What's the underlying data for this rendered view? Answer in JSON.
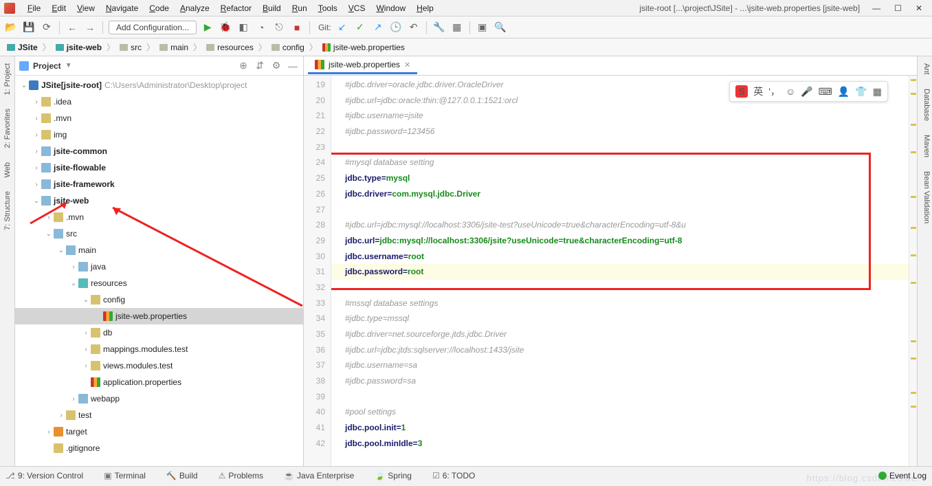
{
  "menus": [
    "File",
    "Edit",
    "View",
    "Navigate",
    "Code",
    "Analyze",
    "Refactor",
    "Build",
    "Run",
    "Tools",
    "VCS",
    "Window",
    "Help"
  ],
  "window_title": "jsite-root [...\\project\\JSite] - ...\\jsite-web.properties [jsite-web]",
  "toolbar": {
    "add_config": "Add Configuration...",
    "git": "Git:"
  },
  "breadcrumbs": [
    "JSite",
    "jsite-web",
    "src",
    "main",
    "resources",
    "config",
    "jsite-web.properties"
  ],
  "project_header": {
    "label": "Project"
  },
  "tree": [
    {
      "indent": 0,
      "arrow": "v",
      "icon": "project",
      "labelA": "JSite",
      "labelB": "[jsite-root]",
      "path": "C:\\Users\\Administrator\\Desktop\\project",
      "bold": true,
      "sel": false
    },
    {
      "indent": 1,
      "arrow": ">",
      "icon": "folder",
      "labelA": ".idea",
      "bold": false
    },
    {
      "indent": 1,
      "arrow": ">",
      "icon": "folder",
      "labelA": ".mvn",
      "bold": false
    },
    {
      "indent": 1,
      "arrow": ">",
      "icon": "folder",
      "labelA": "img",
      "bold": false
    },
    {
      "indent": 1,
      "arrow": ">",
      "icon": "folder-blue",
      "labelA": "jsite-common",
      "bold": true
    },
    {
      "indent": 1,
      "arrow": ">",
      "icon": "folder-blue",
      "labelA": "jsite-flowable",
      "bold": true
    },
    {
      "indent": 1,
      "arrow": ">",
      "icon": "folder-blue",
      "labelA": "jsite-framework",
      "bold": true
    },
    {
      "indent": 1,
      "arrow": "v",
      "icon": "folder-blue",
      "labelA": "jsite-web",
      "bold": true
    },
    {
      "indent": 2,
      "arrow": ">",
      "icon": "folder",
      "labelA": ".mvn",
      "bold": false
    },
    {
      "indent": 2,
      "arrow": "v",
      "icon": "folder-blue",
      "labelA": "src",
      "bold": false
    },
    {
      "indent": 3,
      "arrow": "v",
      "icon": "folder-blue",
      "labelA": "main",
      "bold": false
    },
    {
      "indent": 4,
      "arrow": ">",
      "icon": "folder-blue",
      "labelA": "java",
      "bold": false
    },
    {
      "indent": 4,
      "arrow": "v",
      "icon": "folder-teal",
      "labelA": "resources",
      "bold": false
    },
    {
      "indent": 5,
      "arrow": "v",
      "icon": "folder",
      "labelA": "config",
      "bold": false
    },
    {
      "indent": 6,
      "arrow": "",
      "icon": "properties",
      "labelA": "jsite-web.properties",
      "bold": false,
      "sel": true
    },
    {
      "indent": 5,
      "arrow": ">",
      "icon": "folder",
      "labelA": "db",
      "bold": false
    },
    {
      "indent": 5,
      "arrow": ">",
      "icon": "folder",
      "labelA": "mappings.modules.test",
      "bold": false
    },
    {
      "indent": 5,
      "arrow": ">",
      "icon": "folder",
      "labelA": "views.modules.test",
      "bold": false
    },
    {
      "indent": 5,
      "arrow": "",
      "icon": "properties",
      "labelA": "application.properties",
      "bold": false
    },
    {
      "indent": 4,
      "arrow": ">",
      "icon": "folder-blue",
      "labelA": "webapp",
      "bold": false
    },
    {
      "indent": 3,
      "arrow": ">",
      "icon": "folder",
      "labelA": "test",
      "bold": false
    },
    {
      "indent": 2,
      "arrow": ">",
      "icon": "folder-orange",
      "labelA": "target",
      "bold": false
    },
    {
      "indent": 2,
      "arrow": "",
      "icon": "folder",
      "labelA": ".gitignore",
      "bold": false
    }
  ],
  "editor_tab": "jsite-web.properties",
  "code_lines": [
    {
      "n": 19,
      "t": "comment",
      "text": "#jdbc.driver=oracle.jdbc.driver.OracleDriver"
    },
    {
      "n": 20,
      "t": "comment",
      "text": "#jdbc.url=jdbc:oracle:thin:@127.0.0.1:1521:orcl"
    },
    {
      "n": 21,
      "t": "comment",
      "text": "#jdbc.username=jsite"
    },
    {
      "n": 22,
      "t": "comment",
      "text": "#jdbc.password=123456"
    },
    {
      "n": 23,
      "t": "blank",
      "text": ""
    },
    {
      "n": 24,
      "t": "comment",
      "text": "#mysql database setting"
    },
    {
      "n": 25,
      "t": "prop",
      "key": "jdbc.type",
      "val": "mysql"
    },
    {
      "n": 26,
      "t": "prop",
      "key": "jdbc.driver",
      "val": "com.mysql.jdbc.Driver"
    },
    {
      "n": 27,
      "t": "blank",
      "text": ""
    },
    {
      "n": 28,
      "t": "comment",
      "text": "#jdbc.url=jdbc:mysql://localhost:3306/jsite-test?useUnicode=true&characterEncoding=utf-8&u"
    },
    {
      "n": 29,
      "t": "prop",
      "key": "jdbc.url",
      "val": "jdbc:mysql://localhost:3306/jsite?useUnicode=true&characterEncoding=utf-8"
    },
    {
      "n": 30,
      "t": "prop",
      "key": "jdbc.username",
      "val": "root"
    },
    {
      "n": 31,
      "t": "prop",
      "key": "jdbc.password",
      "val": "root",
      "current": true
    },
    {
      "n": 32,
      "t": "blank",
      "text": ""
    },
    {
      "n": 33,
      "t": "comment",
      "text": "#mssql database settings"
    },
    {
      "n": 34,
      "t": "comment",
      "text": "#jdbc.type=mssql"
    },
    {
      "n": 35,
      "t": "comment",
      "text": "#jdbc.driver=net.sourceforge.jtds.jdbc.Driver"
    },
    {
      "n": 36,
      "t": "comment",
      "text": "#jdbc.url=jdbc:jtds:sqlserver://localhost:1433/jsite"
    },
    {
      "n": 37,
      "t": "comment",
      "text": "#jdbc.username=sa"
    },
    {
      "n": 38,
      "t": "comment",
      "text": "#jdbc.password=sa"
    },
    {
      "n": 39,
      "t": "blank",
      "text": ""
    },
    {
      "n": 40,
      "t": "comment",
      "text": "#pool settings"
    },
    {
      "n": 41,
      "t": "prop",
      "key": "jdbc.pool.init",
      "val": "1"
    },
    {
      "n": 42,
      "t": "prop",
      "key": "jdbc.pool.minIdle",
      "val": "3"
    }
  ],
  "left_tool_tabs": [
    "1: Project",
    "2: Favorites",
    "Web",
    "7: Structure"
  ],
  "right_tool_tabs": [
    "Ant",
    "Database",
    "Maven",
    "Bean Validation"
  ],
  "bottom_tabs": [
    "9: Version Control",
    "Terminal",
    "Build",
    "Problems",
    "Java Enterprise",
    "Spring",
    "6: TODO"
  ],
  "event_log": "Event Log",
  "ime": {
    "logo": "S",
    "lang": "英"
  }
}
